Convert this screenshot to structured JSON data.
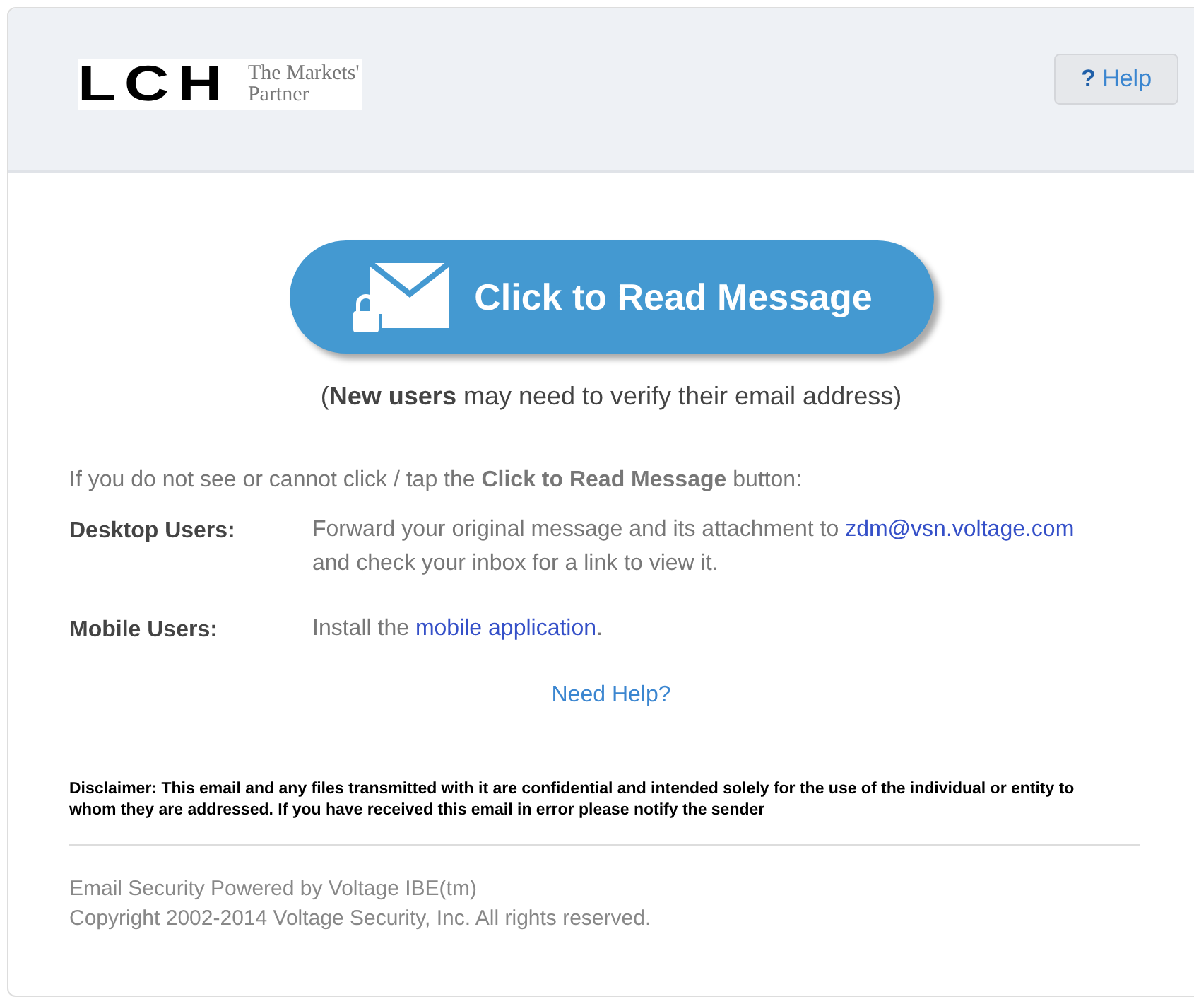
{
  "header": {
    "logo": {
      "wordmark": "LCH",
      "tagline_line_1": "The Markets'",
      "tagline_line_2": "Partner"
    },
    "help_button": {
      "icon": "?",
      "label": "Help"
    }
  },
  "read_button": {
    "label": "Click to Read Message"
  },
  "new_users_note": "(**New users** may need to verify their email address)",
  "intro": "If you do not see or cannot click / tap the **Click to Read Message** button:",
  "instructions": [
    {
      "label": "Desktop Users:",
      "text_before": "Forward your original message and its attachment to",
      "link": "zdm@vsn.voltage.com",
      "text_after": " and check your inbox for a link to view it."
    },
    {
      "label": "Mobile Users:",
      "text_before": "Install the",
      "link": "mobile application",
      "text_after": "."
    }
  ],
  "need_help_link": "Need Help?",
  "disclaimer": "Disclaimer: This email and any files transmitted with it are confidential and intended solely for the use of the individual or entity to whom they are addressed. If you have received this email in error please notify the sender",
  "footer": [
    "Email Security Powered by Voltage IBE(tm)",
    "Copyright 2002-2014 Voltage Security, Inc. All rights reserved."
  ]
}
